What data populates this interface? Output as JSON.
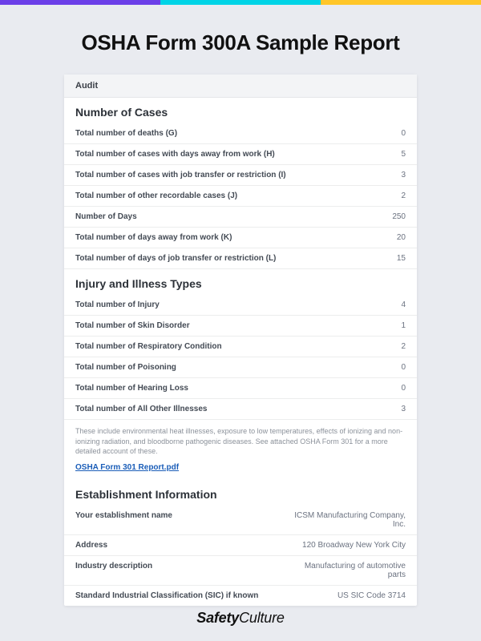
{
  "colors": {
    "purple": "#6b3fe8",
    "cyan": "#00d4e6",
    "yellow": "#ffc629"
  },
  "title": "OSHA Form 300A Sample Report",
  "audit_label": "Audit",
  "sections": {
    "cases": {
      "heading": "Number of Cases",
      "rows": [
        {
          "label": "Total number of deaths (G)",
          "value": "0"
        },
        {
          "label": "Total number of cases with days away from work (H)",
          "value": "5"
        },
        {
          "label": "Total number of cases with job transfer or restriction (I)",
          "value": "3"
        },
        {
          "label": "Total number of other recordable cases (J)",
          "value": "2"
        },
        {
          "label": "Number of Days",
          "value": "250"
        },
        {
          "label": "Total number of days away from work (K)",
          "value": "20"
        },
        {
          "label": "Total number of days of job transfer or restriction (L)",
          "value": "15"
        }
      ]
    },
    "illness": {
      "heading": "Injury and Illness Types",
      "rows": [
        {
          "label": "Total number of Injury",
          "value": "4"
        },
        {
          "label": "Total number of Skin Disorder",
          "value": "1"
        },
        {
          "label": "Total number of Respiratory Condition",
          "value": "2"
        },
        {
          "label": "Total number of Poisoning",
          "value": "0"
        },
        {
          "label": "Total number of Hearing Loss",
          "value": "0"
        },
        {
          "label": "Total number of All Other Illnesses",
          "value": "3"
        }
      ],
      "note": "These include environmental heat illnesses, exposure to low temperatures,  effects of ionizing and non-ionizing radiation, and bloodborne pathogenic diseases. See attached OSHA Form 301 for a more detailed account of these.",
      "link_text": "OSHA Form 301 Report.pdf"
    },
    "establishment": {
      "heading": "Establishment Information",
      "rows": [
        {
          "label": "Your establishment name",
          "value": "ICSM Manufacturing Company, Inc."
        },
        {
          "label": "Address",
          "value": "120 Broadway New York City"
        },
        {
          "label": "Industry description",
          "value": "Manufacturing of automotive parts"
        },
        {
          "label": "Standard Industrial Classification (SIC) if known",
          "value": "US SIC Code 3714"
        }
      ]
    }
  },
  "footer": {
    "brand_bold": "Safety",
    "brand_light": "Culture"
  }
}
